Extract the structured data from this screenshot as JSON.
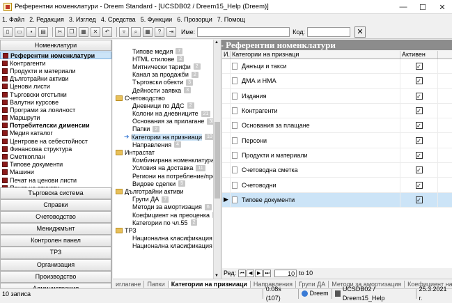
{
  "window": {
    "title": "Референтни номенклатури - Dreem Standard - [UCSDB02 / Dreem15_Help (Dreem)]",
    "minimize": "—",
    "maximize": "☐",
    "close": "✕"
  },
  "menu": [
    "1. Файл",
    "2. Редакция",
    "3. Изглед",
    "4. Средства",
    "5. Функции",
    "6. Прозорци",
    "7. Помощ"
  ],
  "toolbar": {
    "name_label": "Име:",
    "code_label": "Код:",
    "name_value": "",
    "code_value": ""
  },
  "left": {
    "top_section": "Номенклатури",
    "items": [
      {
        "label": "Референтни номенклатури",
        "selected": true
      },
      {
        "label": "Контрагенти"
      },
      {
        "label": "Продукти и материали"
      },
      {
        "label": "Дълготрайни активи"
      },
      {
        "label": "Ценови листи"
      },
      {
        "label": "Търговски отстъпки"
      },
      {
        "label": "Валутни курсове"
      },
      {
        "label": "Програми за лоялност"
      },
      {
        "label": "Маршрути"
      },
      {
        "label": "Потребителски дименсии",
        "bold": true
      },
      {
        "label": "Медия каталог"
      },
      {
        "label": "Центрове на себестойност"
      },
      {
        "label": "Финансова структура"
      },
      {
        "label": "Сметкоплан"
      },
      {
        "label": "Типове документи"
      },
      {
        "label": "Машини"
      },
      {
        "label": "Печат на ценови листи"
      },
      {
        "label": "Печат на етикети"
      }
    ],
    "sections": [
      "Търговска система",
      "Справки",
      "Счетоводство",
      "Мениджмънт",
      "Контролен панел",
      "ТРЗ",
      "Организация",
      "Производство",
      "Администрация"
    ]
  },
  "tree": [
    {
      "label": "Типове медия",
      "count": "7",
      "indent": 1
    },
    {
      "label": "HTML стилове",
      "count": "2",
      "indent": 1
    },
    {
      "label": "Митнически тарифи",
      "count": "2",
      "indent": 1
    },
    {
      "label": "Канал за продажби",
      "count": "2",
      "indent": 1
    },
    {
      "label": "Търговски обекти",
      "count": "3",
      "indent": 1
    },
    {
      "label": "Дейности заявка",
      "count": "3",
      "indent": 1
    },
    {
      "label": "Счетоводство",
      "folder": true,
      "indent": 0
    },
    {
      "label": "Дневници по ДДС",
      "count": "2",
      "indent": 1
    },
    {
      "label": "Колони на дневниците",
      "count": "21",
      "indent": 1
    },
    {
      "label": "Основания за прилагане",
      "count": "30",
      "indent": 1
    },
    {
      "label": "Папки",
      "count": "2",
      "indent": 1
    },
    {
      "label": "Категории на призниаци",
      "count": "10",
      "indent": 1,
      "selected": true
    },
    {
      "label": "Направления",
      "count": "4",
      "indent": 1
    },
    {
      "label": "Интрастат",
      "folder": true,
      "indent": 0
    },
    {
      "label": "Комбинирана номенклатура",
      "count": "",
      "indent": 1
    },
    {
      "label": "Условия на доставка",
      "count": "11",
      "indent": 1
    },
    {
      "label": "Региони на потребление/прои",
      "count": "",
      "indent": 1
    },
    {
      "label": "Видове сделки",
      "count": "5",
      "indent": 1
    },
    {
      "label": "Дълготрайни активи",
      "folder": true,
      "indent": 0
    },
    {
      "label": "Групи ДА",
      "count": "7",
      "indent": 1
    },
    {
      "label": "Методи за амортизация",
      "count": "6",
      "indent": 1
    },
    {
      "label": "Коефициент на преоценка",
      "count": "4",
      "indent": 1
    },
    {
      "label": "Категории по чл.55",
      "count": "2",
      "indent": 1
    },
    {
      "label": "ТРЗ",
      "folder": true,
      "indent": 0
    },
    {
      "label": "Национална класификация на",
      "count": "",
      "indent": 1
    },
    {
      "label": "Национална класификация на",
      "count": "",
      "indent": 1
    }
  ],
  "banner": "Категории на призниаци - Референтни номенклатури",
  "grid": {
    "col_marker": "И...",
    "col_name": "Категории на признаци",
    "col_active": "Активен",
    "rows": [
      {
        "name": "Данъци и такси",
        "active": "✓"
      },
      {
        "name": "ДМА и НМА",
        "active": "✓"
      },
      {
        "name": "Издания",
        "active": "✓"
      },
      {
        "name": "Контрагенти",
        "active": "✓"
      },
      {
        "name": "Основания за плащане",
        "active": "✓"
      },
      {
        "name": "Персони",
        "active": "✓"
      },
      {
        "name": "Продукти и материали",
        "active": "✓"
      },
      {
        "name": "Счетоводна сметка",
        "active": "✓"
      },
      {
        "name": "Счетоводни",
        "active": "✓"
      },
      {
        "name": "Типове документи",
        "active": "✓",
        "selected": true
      }
    ]
  },
  "pager": {
    "label": "Ред:",
    "current": "10",
    "of_label": "to 10"
  },
  "tabs": [
    {
      "label": "иглагане"
    },
    {
      "label": "Папки"
    },
    {
      "label": "Категории на призниаци",
      "active": true
    },
    {
      "label": "Направления"
    },
    {
      "label": "Групи ДА"
    },
    {
      "label": "Методи за амортизация"
    },
    {
      "label": "Коефициент на преоценк"
    }
  ],
  "status": {
    "records": "10 записа",
    "time": "0.08s (107)",
    "app": "Dreem",
    "db": "UCSDB02 / Dreem15_Help",
    "date": "25.3.2021 г."
  },
  "colors": {
    "selection": "#cce4f7",
    "banner": "#8c8c8c",
    "nav_icon": "#8b1a1a"
  }
}
